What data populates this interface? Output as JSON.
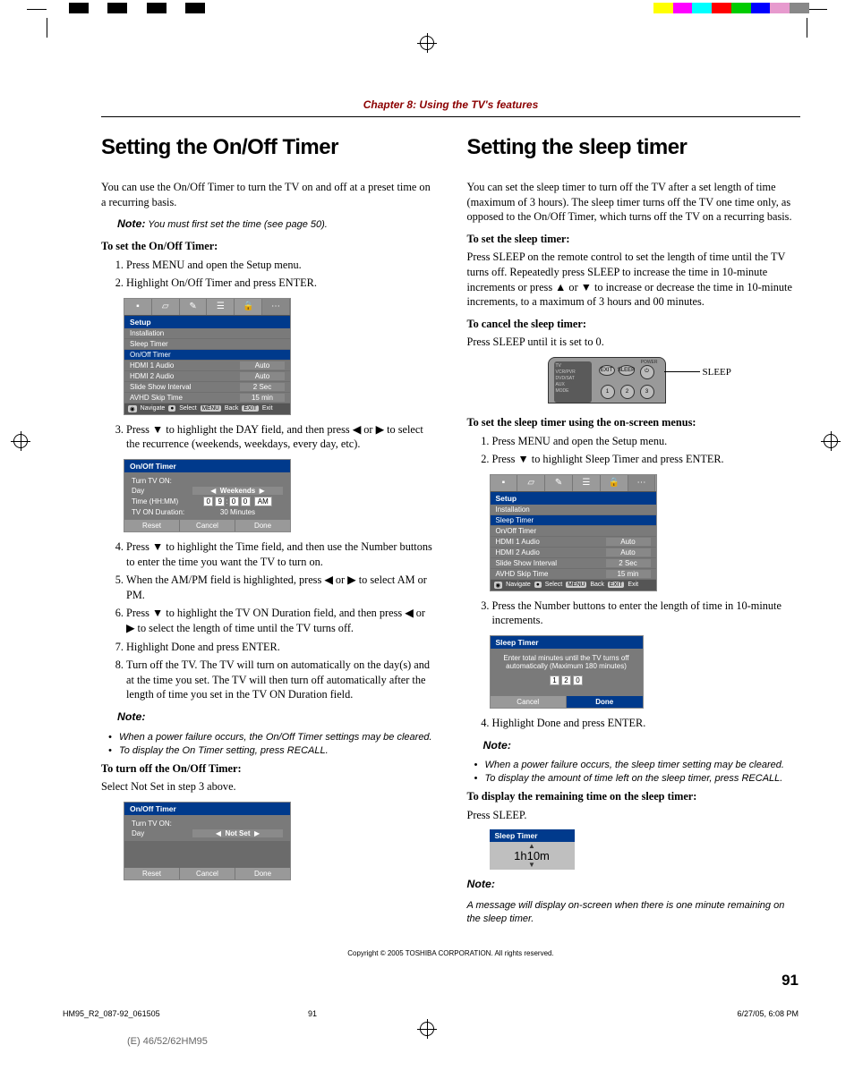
{
  "colorbar": [
    "#fff",
    "#000",
    "#fff",
    "#000",
    "#fff",
    "#000",
    "#fff",
    "#000",
    "#fff",
    "#fff",
    "#fff",
    "#fff",
    "#fff",
    "#fff",
    "#fff",
    "#fff",
    "#fff",
    "#fff",
    "#fff",
    "#fff",
    "#fff",
    "#fff",
    "#fff",
    "#fff",
    "#fff",
    "#fff",
    "#fff",
    "#fff",
    "#fff",
    "#fff",
    "#fff",
    "#fff",
    "#ff0",
    "#f0f",
    "#0ff",
    "#f00",
    "#0c0",
    "#00f",
    "#e79ace",
    "#888"
  ],
  "chapter": "Chapter 8: Using the TV's features",
  "left": {
    "h1": "Setting the On/Off Timer",
    "intro": "You can use the On/Off Timer to turn the TV on and off at a preset time on a recurring basis.",
    "note_label": "Note:",
    "note1": " You must first set the time (see page 50).",
    "sub1": "To set the On/Off Timer:",
    "steps_a": [
      "Press MENU and open the Setup menu.",
      "Highlight On/Off Timer and press ENTER."
    ],
    "osd1": {
      "title": "Setup",
      "rows": [
        {
          "lbl": "Installation",
          "val": ""
        },
        {
          "lbl": "Sleep Timer",
          "val": ""
        },
        {
          "lbl": "On/Off Timer",
          "val": "",
          "hl": true
        },
        {
          "lbl": "HDMI 1 Audio",
          "val": "Auto"
        },
        {
          "lbl": "HDMI 2 Audio",
          "val": "Auto"
        },
        {
          "lbl": "Slide Show Interval",
          "val": "2 Sec"
        },
        {
          "lbl": "AVHD Skip Time",
          "val": "15 min"
        }
      ],
      "footer": [
        "Navigate",
        "Select",
        "Back",
        "Exit"
      ]
    },
    "step3": "Press ▼ to highlight the DAY field, and then press ◀ or ▶ to select the recurrence (weekends, weekdays, every day, etc).",
    "osd2": {
      "title": "On/Off Timer",
      "turn_on": "Turn TV ON:",
      "day_lbl": "Day",
      "day_val": "Weekends",
      "time_lbl": "Time (HH:MM)",
      "time_digits": [
        "0",
        "9",
        ":",
        "0",
        "0"
      ],
      "time_suffix": "AM",
      "dur_lbl": "TV ON Duration:",
      "dur_val": "30 Minutes",
      "btns": [
        "Reset",
        "Cancel",
        "Done"
      ]
    },
    "step4": "Press ▼ to highlight the Time field, and then use the Number buttons to enter the time you want the TV to turn on.",
    "step5": "When the AM/PM field is highlighted, press ◀ or ▶ to select AM or PM.",
    "step6": "Press ▼ to highlight the TV ON Duration field, and then press ◀ or ▶ to select the length of time until the TV turns off.",
    "step7": "Highlight Done and press ENTER.",
    "step8": "Turn off the TV. The TV will turn on automatically on the day(s) and at the time you set. The TV will then turn off automatically after the length of time you set in the TV ON Duration field.",
    "note2_label": "Note:",
    "notes2": [
      "When a power failure occurs, the On/Off Timer settings may be cleared.",
      "To display the On Timer setting, press RECALL."
    ],
    "sub2": "To turn off the On/Off Timer:",
    "p_off": "Select Not Set in step 3 above.",
    "osd3": {
      "title": "On/Off Timer",
      "turn_on": "Turn TV ON:",
      "day_lbl": "Day",
      "day_val": "Not Set",
      "btns": [
        "Reset",
        "Cancel",
        "Done"
      ]
    }
  },
  "right": {
    "h1": "Setting the sleep timer",
    "intro": "You can set the sleep timer to turn off the TV after a set length of time (maximum of 3 hours). The sleep timer turns off the TV one time only, as opposed to the On/Off Timer, which turns off the TV on a recurring basis.",
    "sub1": "To set the sleep timer:",
    "p1": "Press SLEEP on the remote control to set the length of time until the TV turns off. Repeatedly press SLEEP to increase the time in 10-minute increments or press ▲ or ▼ to increase or decrease the time in 10-minute increments, to a maximum of 3 hours and 00 minutes.",
    "sub2": "To cancel the sleep timer:",
    "p2": "Press SLEEP until it is set to 0.",
    "remote": {
      "sleep_label": "SLEEP",
      "power": "POWER",
      "screen_lines": [
        "TV",
        "VCR/PVR",
        "DVD/SAT",
        "AUX",
        "MODE"
      ],
      "nums": [
        "1",
        "2",
        "3"
      ],
      "btn_exit": "EXIT",
      "btn_sleep": "SLEEP"
    },
    "sub3": "To set the sleep timer using the on-screen menus:",
    "steps_b": [
      "Press MENU and open the Setup menu.",
      "Press ▼ to highlight Sleep Timer and press ENTER."
    ],
    "osd1": {
      "title": "Setup",
      "rows": [
        {
          "lbl": "Installation",
          "val": ""
        },
        {
          "lbl": "Sleep Timer",
          "val": "",
          "hl": true
        },
        {
          "lbl": "On/Off Timer",
          "val": ""
        },
        {
          "lbl": "HDMI 1 Audio",
          "val": "Auto"
        },
        {
          "lbl": "HDMI 2 Audio",
          "val": "Auto"
        },
        {
          "lbl": "Slide Show Interval",
          "val": "2 Sec"
        },
        {
          "lbl": "AVHD Skip Time",
          "val": "15 min"
        }
      ],
      "footer": [
        "Navigate",
        "Select",
        "Back",
        "Exit"
      ]
    },
    "step3": "Press the Number buttons to enter the length of time in 10-minute increments.",
    "dialog": {
      "title": "Sleep Timer",
      "msg": "Enter total minutes until the TV turns off automatically (Maximum 180 minutes)",
      "digits": [
        "1",
        "2",
        "0"
      ],
      "btns": [
        "Cancel",
        "Done"
      ]
    },
    "step4": "Highlight Done and press ENTER.",
    "note_label": "Note:",
    "notes": [
      "When a power failure occurs, the sleep timer setting may be cleared.",
      "To display the amount of time left on the sleep timer, press RECALL."
    ],
    "sub4": "To display the remaining time on the sleep timer:",
    "p4": "Press SLEEP.",
    "remain": {
      "title": "Sleep Timer",
      "value": "1h10m"
    },
    "note2_label": "Note:",
    "note2": "A message will display on-screen when there is one minute remaining on the sleep timer."
  },
  "copyright": "Copyright © 2005 TOSHIBA CORPORATION. All rights reserved.",
  "page_num": "91",
  "footer": {
    "file": "HM95_R2_087-92_061505",
    "pg": "91",
    "dt": "6/27/05, 6:08 PM"
  },
  "bottom_code": "(E) 46/52/62HM95"
}
